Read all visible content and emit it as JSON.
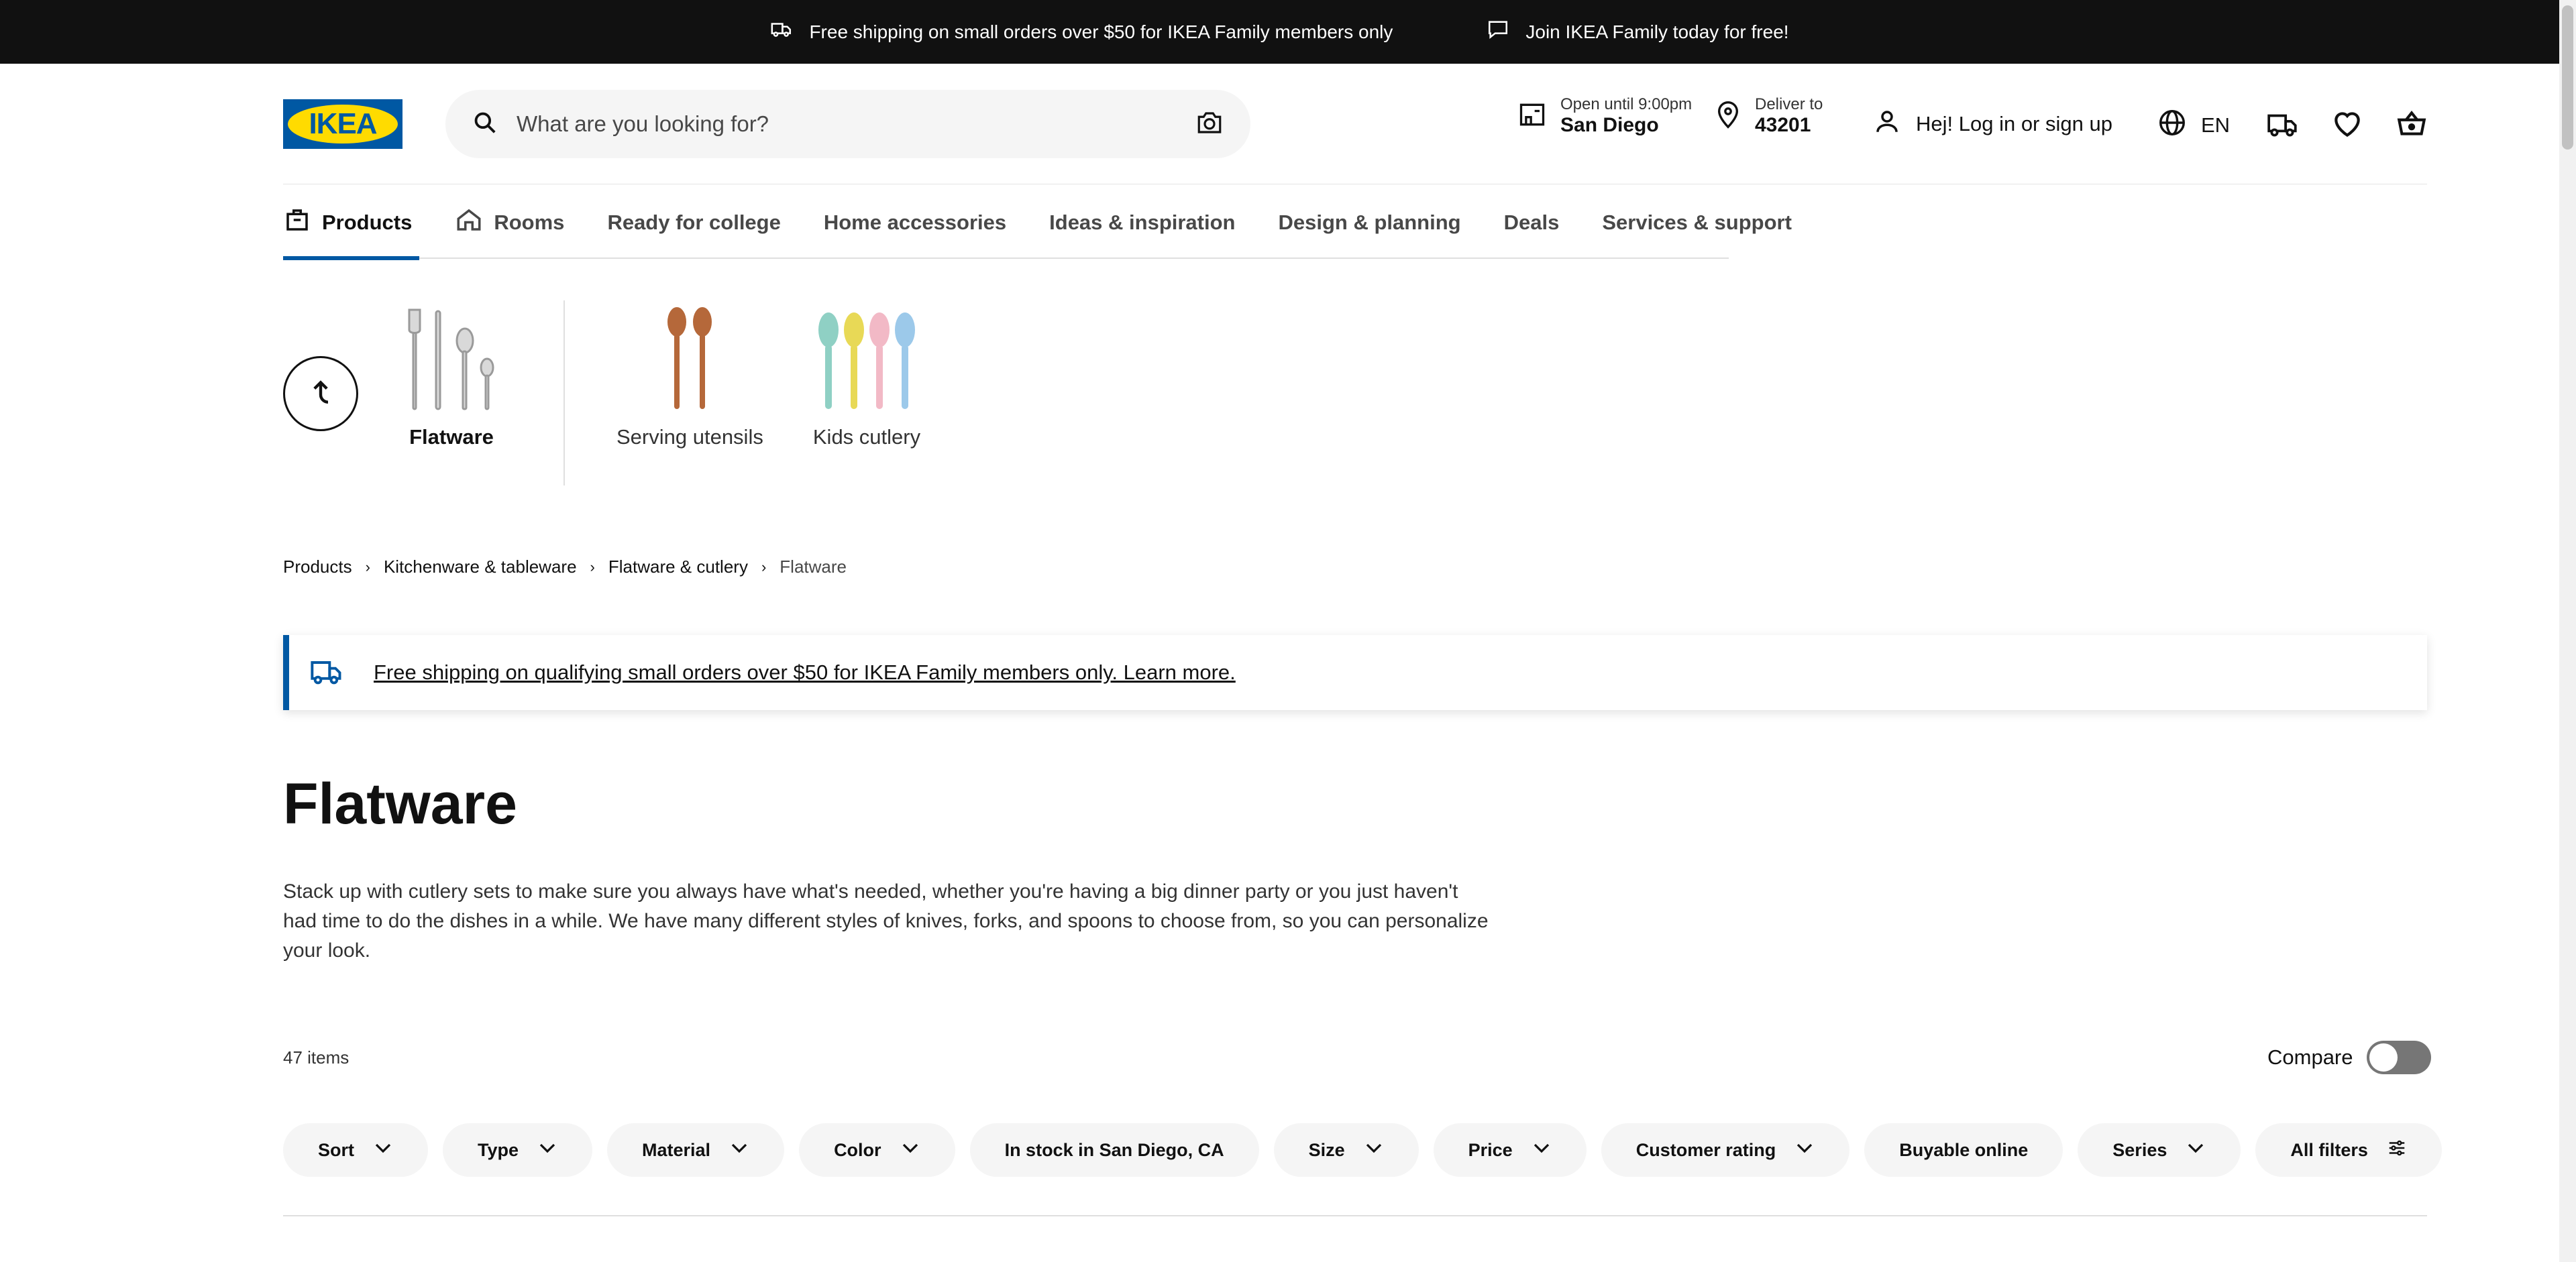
{
  "topbar": {
    "shipping_msg": "Free shipping on small orders over $50 for IKEA Family members only",
    "family_msg": "Join IKEA Family today for free!"
  },
  "header": {
    "logo_text": "IKEA",
    "search_placeholder": "What are you looking for?",
    "store_hours": "Open until 9:00pm",
    "store_name": "San Diego",
    "deliver_label": "Deliver to",
    "deliver_zip": "43201",
    "login_label": "Hej! Log in or sign up",
    "language": "EN"
  },
  "nav": {
    "items": [
      "Products",
      "Rooms",
      "Ready for college",
      "Home accessories",
      "Ideas & inspiration",
      "Design & planning",
      "Deals",
      "Services & support"
    ]
  },
  "categories": [
    "Flatware",
    "Serving utensils",
    "Kids cutlery"
  ],
  "breadcrumb": [
    "Products",
    "Kitchenware & tableware",
    "Flatware & cutlery",
    "Flatware"
  ],
  "info_banner": "Free shipping on qualifying small orders over $50 for IKEA Family members only. Learn more.",
  "page": {
    "title": "Flatware",
    "description": "Stack up with cutlery sets to make sure you always have what's needed, whether you're having a big dinner party or you just haven't had time to do the dishes in a while. We have many different styles of knives, forks, and spoons to choose from, so you can personalize your look.",
    "count": "47 items",
    "compare_label": "Compare"
  },
  "filters": [
    "Sort",
    "Type",
    "Material",
    "Color",
    "In stock in San Diego, CA",
    "Size",
    "Price",
    "Customer rating",
    "Buyable online",
    "Series",
    "All filters"
  ],
  "colors": {
    "brand_blue": "#0058a3",
    "brand_yellow": "#ffdb00",
    "topbar": "#111111"
  }
}
